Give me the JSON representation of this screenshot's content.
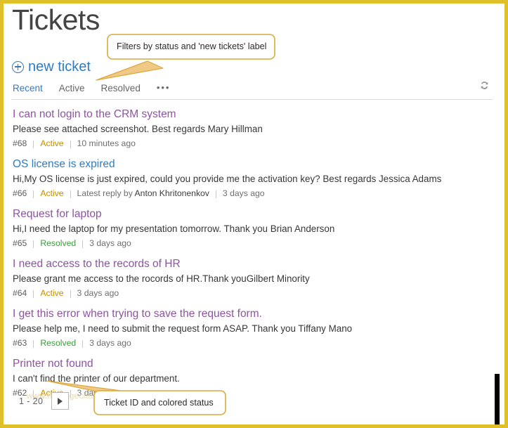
{
  "header": {
    "page_title": "Tickets"
  },
  "toolbar": {
    "new_ticket_label": "new ticket",
    "new_ticket_icon": "plus-circle-icon",
    "refresh_icon": "refresh-icon"
  },
  "tabs": [
    {
      "label": "Recent",
      "active": true
    },
    {
      "label": "Active",
      "active": false
    },
    {
      "label": "Resolved",
      "active": false
    },
    {
      "label": "•••",
      "active": false
    }
  ],
  "tickets": [
    {
      "title": "I can not login to the CRM system",
      "visited": true,
      "excerpt": "Please see attached screenshot. Best regards Mary Hillman",
      "id": "#68",
      "status": "Active",
      "status_kind": "active",
      "reply": "",
      "reply_name": "",
      "time": "10 minutes ago"
    },
    {
      "title": "OS license is expired",
      "visited": false,
      "excerpt": "Hi,My OS license is just expired, could you provide me the activation key? Best regards Jessica Adams",
      "id": "#66",
      "status": "Active",
      "status_kind": "active",
      "reply": "Latest reply by",
      "reply_name": "Anton Khritonenkov",
      "time": "3 days ago"
    },
    {
      "title": "Request for laptop",
      "visited": true,
      "excerpt": "Hi,I need the laptop for my presentation tomorrow. Thank you Brian Anderson",
      "id": "#65",
      "status": "Resolved",
      "status_kind": "resolved",
      "reply": "",
      "reply_name": "",
      "time": "3 days ago"
    },
    {
      "title": "I need access to the records of HR",
      "visited": true,
      "excerpt": "Please grant me access to the rocords of HR.Thank youGilbert Minority",
      "id": "#64",
      "status": "Active",
      "status_kind": "active",
      "reply": "",
      "reply_name": "",
      "time": "3 days ago"
    },
    {
      "title": "I get this error when trying to save the request form.",
      "visited": true,
      "excerpt": "Please help me, I need to submit the request form ASAP. Thank you Tiffany Mano",
      "id": "#63",
      "status": "Resolved",
      "status_kind": "resolved",
      "reply": "",
      "reply_name": "",
      "time": "3 days ago"
    },
    {
      "title": "Printer not found",
      "visited": true,
      "excerpt": "I can't find the printer of our department.",
      "id": "#62",
      "status": "Active",
      "status_kind": "active",
      "reply": "",
      "reply_name": "",
      "time": "3 days ago"
    }
  ],
  "pagination": {
    "range": "1 - 20",
    "next_icon": "next-page-arrow-icon"
  },
  "watermark": {
    "text": "www.heritagechnologies.com"
  },
  "annotations": [
    {
      "text": "Filters by status and 'new tickets' label"
    },
    {
      "text": "Ticket ID and colored status"
    }
  ],
  "colors": {
    "frame_border": "#e0c02a",
    "link_blue": "#2f7cc4",
    "visited_purple": "#8c54a0",
    "status_active": "#bf9000",
    "status_resolved": "#3c9b3c",
    "callout_stroke": "#dba93c"
  }
}
